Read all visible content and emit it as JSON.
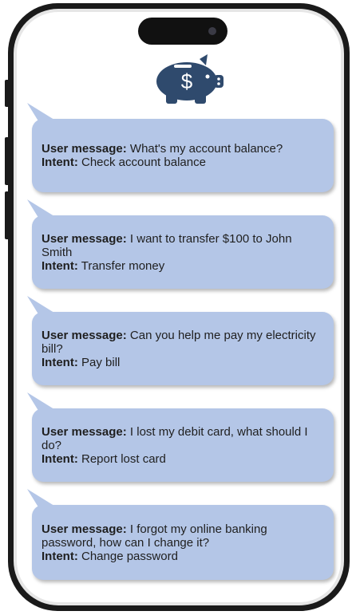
{
  "colors": {
    "bubble": "#b4c6e7",
    "logo": "#2f4a6d",
    "frame": "#1a1a1a"
  },
  "logo_icon": "piggy-bank-dollar-icon",
  "logo_symbol": "$",
  "labels": {
    "user_message": "User message:",
    "intent": "Intent:"
  },
  "messages": [
    {
      "user": "What's my account balance?",
      "intent": "Check account balance"
    },
    {
      "user": "I want to transfer $100 to John Smith",
      "intent": "Transfer money"
    },
    {
      "user": "Can you help me pay my electricity bill?",
      "intent": "Pay bill"
    },
    {
      "user": "I lost my debit card, what should I do?",
      "intent": "Report lost card"
    },
    {
      "user": "I forgot my online banking password, how can I change it?",
      "intent": "Change password"
    }
  ]
}
